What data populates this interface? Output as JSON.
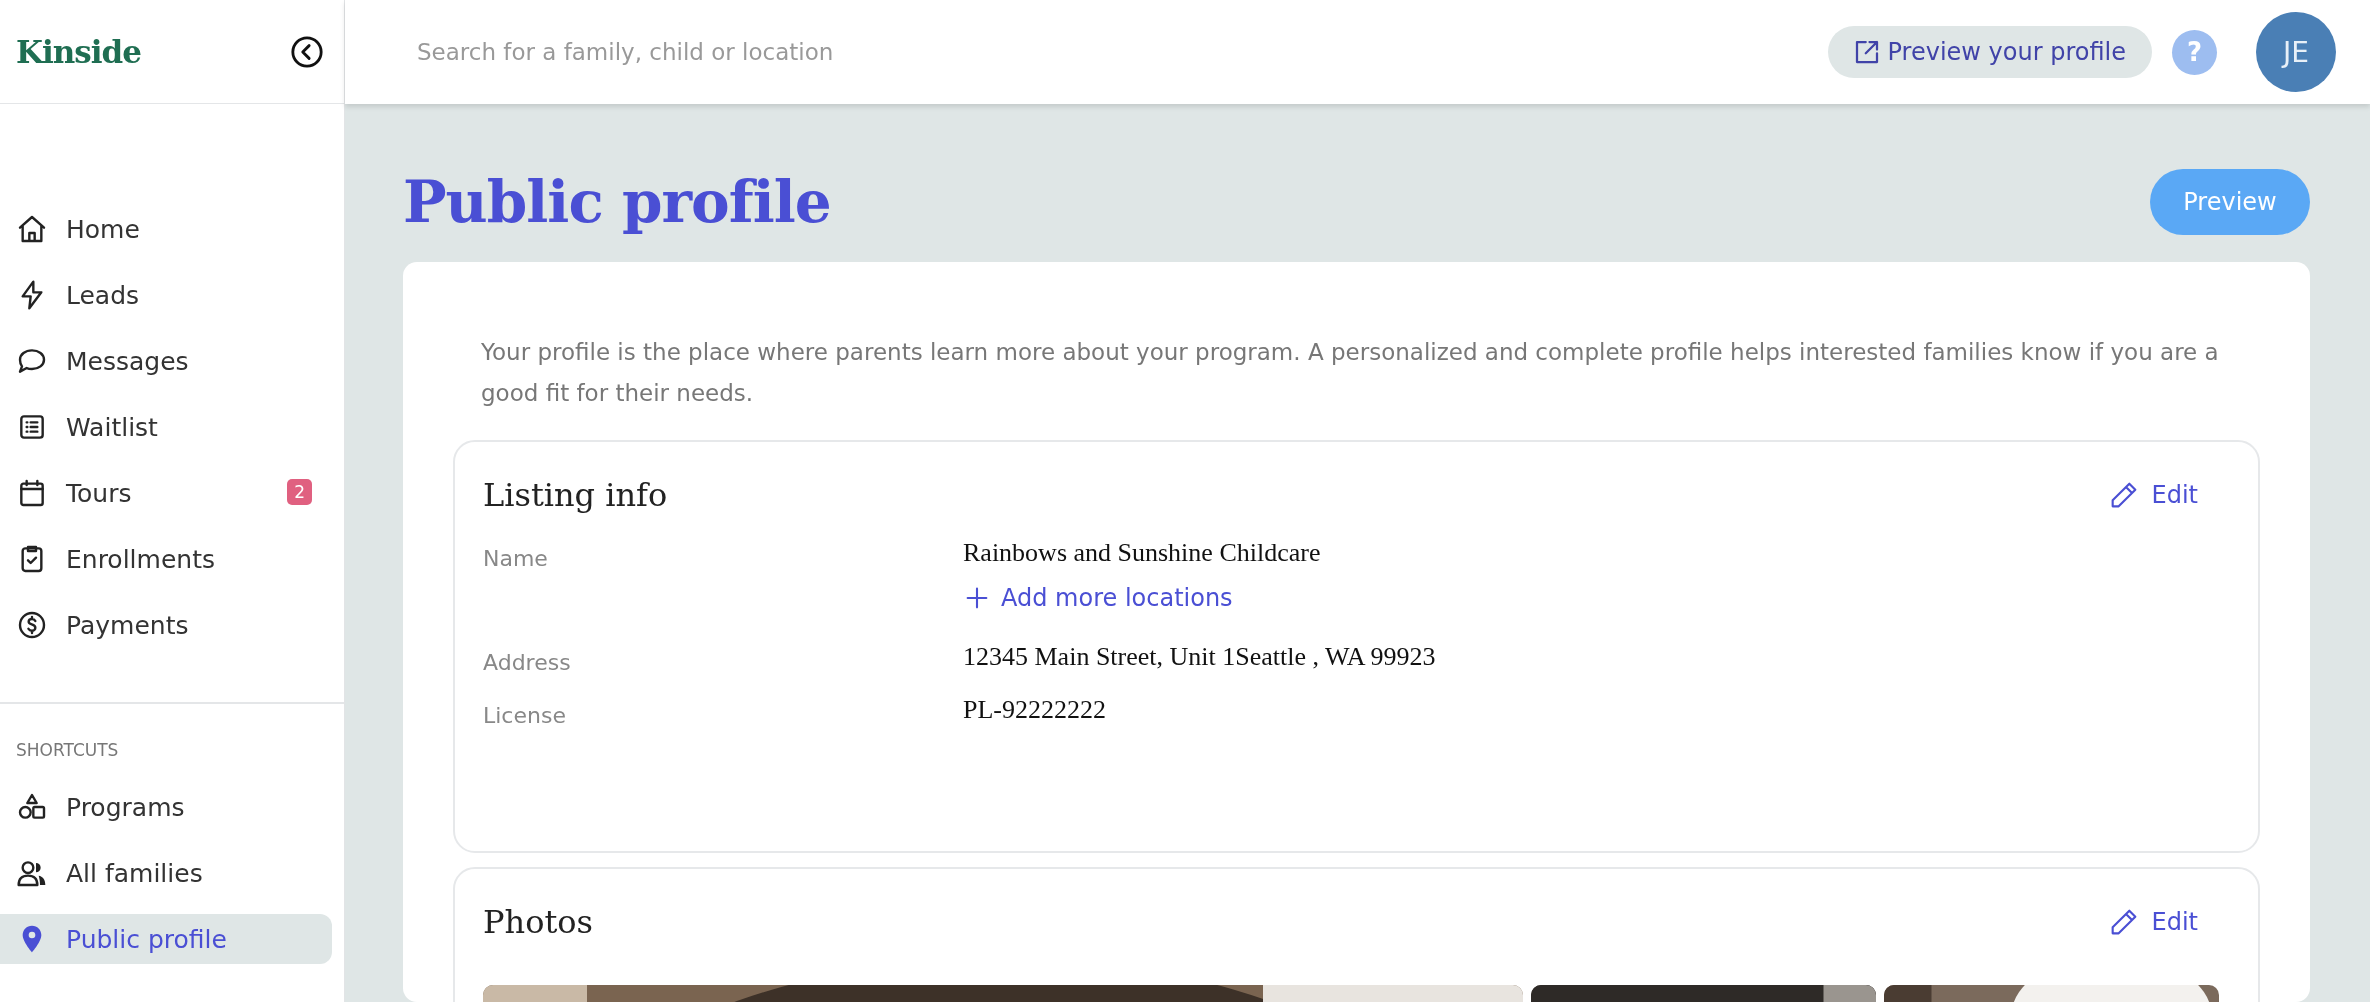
{
  "sidebar": {
    "logo": "Kinside",
    "nav": [
      {
        "label": "Home",
        "selected": false
      },
      {
        "label": "Leads",
        "selected": false
      },
      {
        "label": "Messages",
        "selected": false
      },
      {
        "label": "Waitlist",
        "selected": false
      },
      {
        "label": "Tours",
        "selected": false,
        "badge": "2"
      },
      {
        "label": "Enrollments",
        "selected": false
      },
      {
        "label": "Payments",
        "selected": false
      }
    ],
    "shortcuts_heading": "SHORTCUTS",
    "shortcuts": [
      {
        "label": "Programs",
        "selected": false
      },
      {
        "label": "All families",
        "selected": false
      },
      {
        "label": "Public profile",
        "selected": true
      }
    ]
  },
  "topbar": {
    "search": {
      "placeholder": "Search for a family, child or location"
    },
    "preview_button": "Preview your profile",
    "help": "?",
    "avatar": "JE"
  },
  "page": {
    "title": "Public profile",
    "preview_button": "Preview",
    "intro": "Your profile is the place where parents learn more about your program. A personalized and complete profile helps interested families know if you are a good fit for their needs.",
    "listing": {
      "title": "Listing info",
      "edit": "Edit",
      "fields": [
        {
          "label": "Name",
          "value": "Rainbows and Sunshine Childcare",
          "action": "Add more locations"
        },
        {
          "label": "Address",
          "value": "12345 Main Street, Unit 1Seattle , WA 99923"
        },
        {
          "label": "License",
          "value": "PL-92222222"
        }
      ]
    },
    "photos": {
      "title": "Photos",
      "edit": "Edit"
    }
  }
}
